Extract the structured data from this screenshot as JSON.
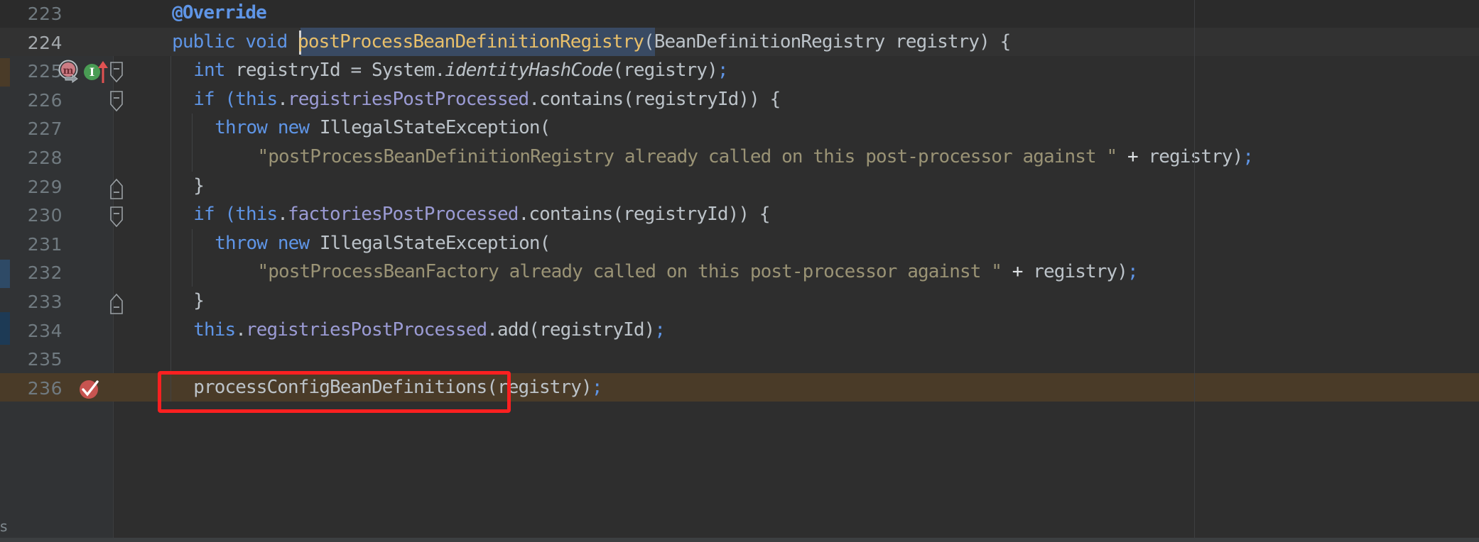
{
  "editor": {
    "app": "IntelliJ IDEA code editor",
    "language": "Java",
    "theme": "Darcula",
    "colors": {
      "background": "#2e2e2e",
      "gutter_background": "#313335",
      "line_number": "#707a80",
      "current_line_number": "#a4a9ad",
      "keyword": "#cc7832",
      "annotation": "#5f95e6",
      "keyword_blue": "#5f95e6",
      "field": "#9b9bd4",
      "method_declaration": "#e8bf6a",
      "string": "#9a9375",
      "default_text": "#a9b7c6",
      "selection": "#394a63",
      "caret": "#d4d4d4",
      "breakpoint_line": "#4a3b28",
      "breakpoint_red": "#db5860",
      "implemented_green": "#499c54",
      "override_pink": "#cc7c84",
      "annotation_box": "#fb2020"
    },
    "selection": {
      "text": "postProcessBeanDefinitionRegistry",
      "line": 224
    },
    "caret": {
      "line": 224,
      "column": 17
    },
    "annotation_box": {
      "label": "highlight-rectangle",
      "target_line": 236,
      "target_text": "processConfigBeanDefinitions(registry);",
      "color": "#fb2020"
    },
    "gutter_icons": [
      {
        "line": 224,
        "name": "override-method-marker",
        "glyph": "m",
        "tooltip": "Overrides method"
      },
      {
        "line": 224,
        "name": "implemented-method-marker",
        "glyph": "I",
        "tooltip": "Implements method"
      },
      {
        "line": 236,
        "name": "breakpoint-verified",
        "glyph": "check",
        "tooltip": "Line breakpoint verified"
      }
    ],
    "fold_markers": [
      {
        "line": 224,
        "type": "collapse-minus"
      },
      {
        "line": 226,
        "type": "collapse-minus"
      },
      {
        "line": 229,
        "type": "fold-end"
      },
      {
        "line": 230,
        "type": "collapse-minus"
      },
      {
        "line": 233,
        "type": "fold-end"
      }
    ],
    "edge_label": "s",
    "lines": [
      {
        "number": "223",
        "indent": 1,
        "bg": "dark",
        "tokens": [
          {
            "text": "@Override",
            "cls": "t-anno"
          }
        ]
      },
      {
        "number": "224",
        "indent": 1,
        "bg": "caret",
        "current": true,
        "tokens": [
          {
            "text": "public void ",
            "cls": "t-blue"
          },
          {
            "text": "postProcessBeanDefinitionRegistry",
            "cls": "t-method"
          },
          {
            "text": "(",
            "cls": "t-plain"
          },
          {
            "text": "BeanDefinitionRegistry registry",
            "cls": "t-type"
          },
          {
            "text": ") {",
            "cls": "t-plain"
          }
        ]
      },
      {
        "number": "225",
        "indent": 2,
        "bg": "default",
        "tokens": [
          {
            "text": "int ",
            "cls": "t-blue"
          },
          {
            "text": "registryId = System.",
            "cls": "t-plain"
          },
          {
            "text": "identityHashCode",
            "cls": "t-static"
          },
          {
            "text": "(registry)",
            "cls": "t-plain"
          },
          {
            "text": ";",
            "cls": "t-semi"
          }
        ]
      },
      {
        "number": "226",
        "indent": 2,
        "bg": "default",
        "tokens": [
          {
            "text": "if (",
            "cls": "t-blue"
          },
          {
            "text": "this",
            "cls": "t-blue"
          },
          {
            "text": ".",
            "cls": "t-plain"
          },
          {
            "text": "registriesPostProcessed",
            "cls": "t-field"
          },
          {
            "text": ".contains(registryId)) {",
            "cls": "t-plain"
          }
        ]
      },
      {
        "number": "227",
        "indent": 3,
        "bg": "default",
        "tokens": [
          {
            "text": "throw new ",
            "cls": "t-blue"
          },
          {
            "text": "IllegalStateException(",
            "cls": "t-plain"
          }
        ]
      },
      {
        "number": "228",
        "indent": 5,
        "bg": "default",
        "tokens": [
          {
            "text": "\"postProcessBeanDefinitionRegistry already called on this post-processor against \"",
            "cls": "t-str"
          },
          {
            "text": " + ",
            "cls": "t-white"
          },
          {
            "text": "registry)",
            "cls": "t-plain"
          },
          {
            "text": ";",
            "cls": "t-semi"
          }
        ]
      },
      {
        "number": "229",
        "indent": 2,
        "bg": "default",
        "tokens": [
          {
            "text": "}",
            "cls": "t-brace"
          }
        ]
      },
      {
        "number": "230",
        "indent": 2,
        "bg": "default",
        "tokens": [
          {
            "text": "if (",
            "cls": "t-blue"
          },
          {
            "text": "this",
            "cls": "t-blue"
          },
          {
            "text": ".",
            "cls": "t-plain"
          },
          {
            "text": "factoriesPostProcessed",
            "cls": "t-field"
          },
          {
            "text": ".contains(registryId)) {",
            "cls": "t-plain"
          }
        ]
      },
      {
        "number": "231",
        "indent": 3,
        "bg": "default",
        "tokens": [
          {
            "text": "throw new ",
            "cls": "t-blue"
          },
          {
            "text": "IllegalStateException(",
            "cls": "t-plain"
          }
        ]
      },
      {
        "number": "232",
        "indent": 5,
        "bg": "default",
        "tokens": [
          {
            "text": "\"postProcessBeanFactory already called on this post-processor against \"",
            "cls": "t-str"
          },
          {
            "text": " + ",
            "cls": "t-white"
          },
          {
            "text": "registry)",
            "cls": "t-plain"
          },
          {
            "text": ";",
            "cls": "t-semi"
          }
        ]
      },
      {
        "number": "233",
        "indent": 2,
        "bg": "default",
        "tokens": [
          {
            "text": "}",
            "cls": "t-brace"
          }
        ]
      },
      {
        "number": "234",
        "indent": 2,
        "bg": "default",
        "tokens": [
          {
            "text": "this",
            "cls": "t-blue"
          },
          {
            "text": ".",
            "cls": "t-plain"
          },
          {
            "text": "registriesPostProcessed",
            "cls": "t-field"
          },
          {
            "text": ".add(registryId)",
            "cls": "t-plain"
          },
          {
            "text": ";",
            "cls": "t-semi"
          }
        ]
      },
      {
        "number": "235",
        "indent": 2,
        "bg": "default",
        "tokens": []
      },
      {
        "number": "236",
        "indent": 2,
        "bg": "break",
        "tokens": [
          {
            "text": "processConfigBeanDefinitions(registry)",
            "cls": "t-plain"
          },
          {
            "text": ";",
            "cls": "t-semi"
          }
        ]
      }
    ]
  }
}
